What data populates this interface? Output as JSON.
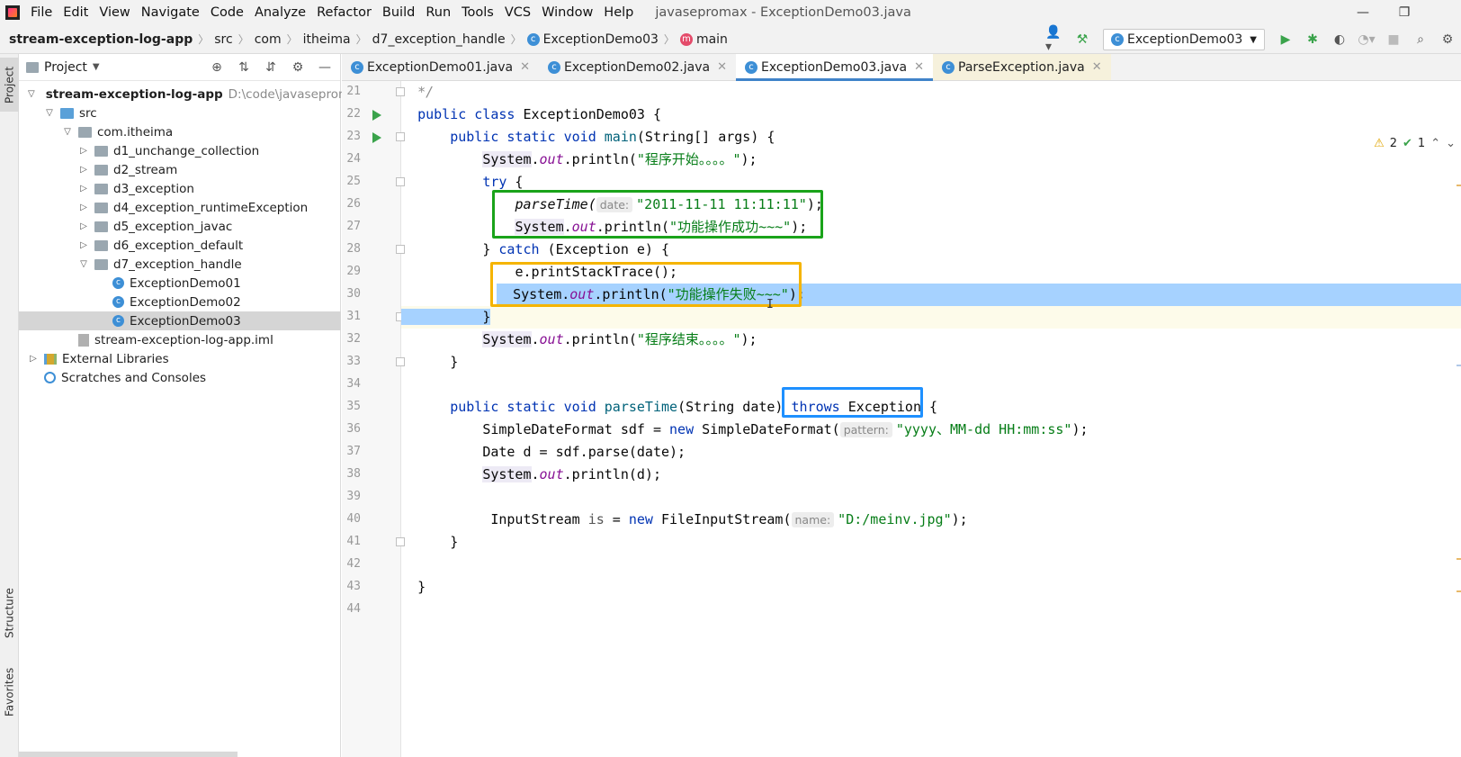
{
  "menubar": {
    "items": [
      "File",
      "Edit",
      "View",
      "Navigate",
      "Code",
      "Analyze",
      "Refactor",
      "Build",
      "Run",
      "Tools",
      "VCS",
      "Window",
      "Help"
    ],
    "window_title": "javasepromax - ExceptionDemo03.java"
  },
  "navbar": {
    "breadcrumbs": [
      "stream-exception-log-app",
      "src",
      "com",
      "itheima",
      "d7_exception_handle",
      "ExceptionDemo03",
      "main"
    ],
    "run_config": "ExceptionDemo03"
  },
  "left_strip": {
    "project_tab": "Project",
    "structure_tab": "Structure",
    "favorites_tab": "Favorites"
  },
  "project_panel": {
    "title": "Project",
    "tree": [
      {
        "label": "stream-exception-log-app",
        "path": "D:\\code\\javasepromax\\",
        "kind": "module",
        "depth": 0,
        "expanded": true
      },
      {
        "label": "src",
        "kind": "src",
        "depth": 1,
        "expanded": true
      },
      {
        "label": "com.itheima",
        "kind": "package",
        "depth": 2,
        "expanded": true
      },
      {
        "label": "d1_unchange_collection",
        "kind": "package",
        "depth": 3,
        "expanded": false
      },
      {
        "label": "d2_stream",
        "kind": "package",
        "depth": 3,
        "expanded": false
      },
      {
        "label": "d3_exception",
        "kind": "package",
        "depth": 3,
        "expanded": false
      },
      {
        "label": "d4_exception_runtimeException",
        "kind": "package",
        "depth": 3,
        "expanded": false
      },
      {
        "label": "d5_exception_javac",
        "kind": "package",
        "depth": 3,
        "expanded": false
      },
      {
        "label": "d6_exception_default",
        "kind": "package",
        "depth": 3,
        "expanded": false
      },
      {
        "label": "d7_exception_handle",
        "kind": "package",
        "depth": 3,
        "expanded": true
      },
      {
        "label": "ExceptionDemo01",
        "kind": "class",
        "depth": 4
      },
      {
        "label": "ExceptionDemo02",
        "kind": "class",
        "depth": 4
      },
      {
        "label": "ExceptionDemo03",
        "kind": "class",
        "depth": 4,
        "selected": true
      },
      {
        "label": "stream-exception-log-app.iml",
        "kind": "iml",
        "depth": 2
      },
      {
        "label": "External Libraries",
        "kind": "lib",
        "depth": 0,
        "expanded": false
      },
      {
        "label": "Scratches and Consoles",
        "kind": "scratch",
        "depth": 0
      }
    ]
  },
  "editor": {
    "tabs": [
      {
        "label": "ExceptionDemo01.java",
        "active": false
      },
      {
        "label": "ExceptionDemo02.java",
        "active": false
      },
      {
        "label": "ExceptionDemo03.java",
        "active": true
      },
      {
        "label": "ParseException.java",
        "active": false
      }
    ],
    "inspections": {
      "warnings": "2",
      "weak_warnings": "1"
    },
    "line_numbers": [
      "21",
      "22",
      "23",
      "24",
      "25",
      "26",
      "27",
      "28",
      "29",
      "30",
      "31",
      "32",
      "33",
      "34",
      "35",
      "36",
      "37",
      "38",
      "39",
      "40",
      "41",
      "42",
      "43",
      "44"
    ],
    "code": {
      "l21": "*/",
      "l22_kw": "public class",
      "l22_name": " ExceptionDemo03 {",
      "l23_kw": "public static void",
      "l23_fn": "main",
      "l23_rest": "(String[] args) {",
      "sys": "System",
      "dot": ".",
      "out": "out",
      "println": ".println(",
      "l24_str": "\"程序开始。。。。\"",
      "close_paren": ");",
      "l25_kw": "try",
      "l25_rest": " {",
      "l26_fn": "parseTime(",
      "l26_hint": "date:",
      "l26_str": "\"2011-11-11 11:11:11\"",
      "l27_str": "\"功能操作成功~~~\"",
      "l28_a": "} ",
      "l28_kw": "catch",
      "l28_rest": " (Exception e) {",
      "l29": "e.printStackTrace();",
      "l30_str": "\"功能操作失败~~~\"",
      "l31": "}",
      "l32_str": "\"程序结束。。。。\"",
      "l33": "}",
      "l35_kw": "public static void",
      "l35_fn": "parseTime",
      "l35_rest": "(String date) ",
      "l35_throws": "throws",
      "l35_exc": " Exception",
      "l35_end": " {",
      "l36_a": "SimpleDateFormat sdf = ",
      "l36_kw": "new",
      "l36_b": " SimpleDateFormat(",
      "l36_hint": "pattern:",
      "l36_str": "\"yyyy、MM-dd HH:mm:ss\"",
      "l37": "Date d = sdf.parse(date);",
      "l38_rest": ".println(d);",
      "l40_a": "InputStream ",
      "l40_is": "is",
      "l40_b": " = ",
      "l40_kw": "new",
      "l40_c": " FileInputStream(",
      "l40_hint": "name:",
      "l40_str": "\"D:/meinv.jpg\"",
      "l41": "}",
      "l43": "}"
    },
    "annotations": {
      "green": "#1aa31a",
      "orange": "#f5b400",
      "blue": "#1e90ff"
    }
  }
}
